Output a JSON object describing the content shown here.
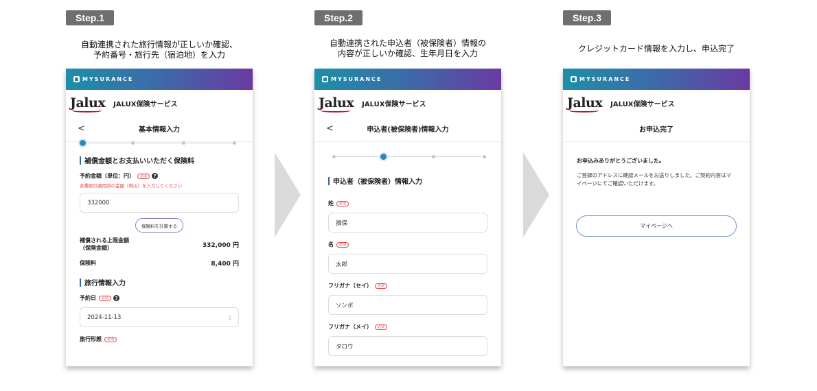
{
  "steps": [
    {
      "badge": "Step.1",
      "caption_line1": "自動連携された旅行情報が正しいか確認、",
      "caption_line2": "予約番号・旅行先（宿泊地）を入力",
      "app_logo": "MYSURANCE",
      "brand_logo": "Jalux",
      "brand_name": "JALUX保険サービス",
      "page_title": "基本情報入力",
      "section1_title": "補償金額とお支払いいただく保険料",
      "amount_label": "予約金額（単位：円）",
      "required": "必須",
      "amount_note": "各種割引適用前の金額（税込）を入力してください",
      "amount_value": "332000",
      "calc_button": "保険料を計算する",
      "limit_label_line1": "補償される上限金額",
      "limit_label_line2": "（保険金額）",
      "limit_value": "332,000 円",
      "premium_label": "保険料",
      "premium_value": "8,400 円",
      "section2_title": "旅行情報入力",
      "date_label": "予約日",
      "date_value": "2024-11-13",
      "type_label": "旅行形態"
    },
    {
      "badge": "Step.2",
      "caption_line1": "自動連携された申込者（被保険者）情報の",
      "caption_line2": "内容が正しいか確認、生年月日を入力",
      "app_logo": "MYSURANCE",
      "brand_logo": "Jalux",
      "brand_name": "JALUX保険サービス",
      "page_title": "申込者(被保険者)情報入力",
      "section_title": "申込者（被保険者）情報入力",
      "required": "必須",
      "fields": [
        {
          "label": "姓",
          "value": "損保"
        },
        {
          "label": "名",
          "value": "太郎"
        },
        {
          "label": "フリガナ（セイ）",
          "value": "ソンポ"
        },
        {
          "label": "フリガナ（メイ）",
          "value": "タロウ"
        }
      ]
    },
    {
      "badge": "Step.3",
      "caption_line1": "クレジットカード情報を入力し、申込完了",
      "app_logo": "MYSURANCE",
      "brand_logo": "Jalux",
      "brand_name": "JALUX保険サービス",
      "page_title": "お申込完了",
      "thanks_title": "お申込みありがとうございました。",
      "thanks_body": "ご登録のアドレスに確認メールをお送りしました。ご契約内容はマイページにてご確認いただけます。",
      "mypage_button": "マイページへ"
    }
  ],
  "icons": {
    "back": "chevron-left-icon",
    "help": "question-icon",
    "calendar": "calendar-icon"
  },
  "colors": {
    "header_gradient_start": "#1e8fa8",
    "header_gradient_end": "#6a3aa2",
    "accent": "#2b86c5",
    "required": "#e24a4a",
    "badge": "#6f6f6f"
  },
  "progress": [
    {
      "steps_total": 4,
      "active_index": 0
    },
    {
      "steps_total": 4,
      "active_index": 1
    }
  ]
}
